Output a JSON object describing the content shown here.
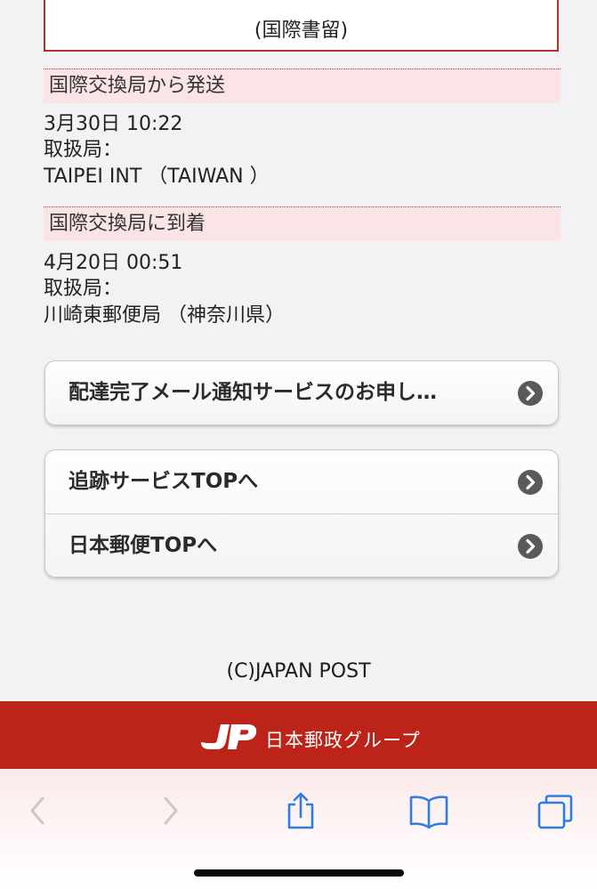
{
  "top_box": {
    "text": "(国際書留)"
  },
  "events": [
    {
      "status": "国際交換局から発送",
      "datetime": "3月30日 10:22",
      "office_label": "取扱局：",
      "office": "TAIPEI INT （TAIWAN ）"
    },
    {
      "status": "国際交換局に到着",
      "datetime": "4月20日 00:51",
      "office_label": "取扱局：",
      "office": "川崎東郵便局 （神奈川県）"
    }
  ],
  "buttons": {
    "notify": "配達完了メール通知サービスのお申し…",
    "tracking_top": "追跡サービスTOPへ",
    "jp_top": "日本郵便TOPへ"
  },
  "footer": {
    "copyright": "(C)JAPAN POST",
    "logo_mark": "JP",
    "logo_text": "日本郵政グループ"
  },
  "toolbar": {
    "icons": [
      "back-icon",
      "forward-icon",
      "share-icon",
      "bookmarks-icon",
      "tabs-icon"
    ]
  },
  "colors": {
    "brand_red": "#bd2419",
    "header_pink": "#fbe4e5",
    "chevron_gray": "#5a5a5a",
    "ios_blue": "#2f7de1"
  }
}
